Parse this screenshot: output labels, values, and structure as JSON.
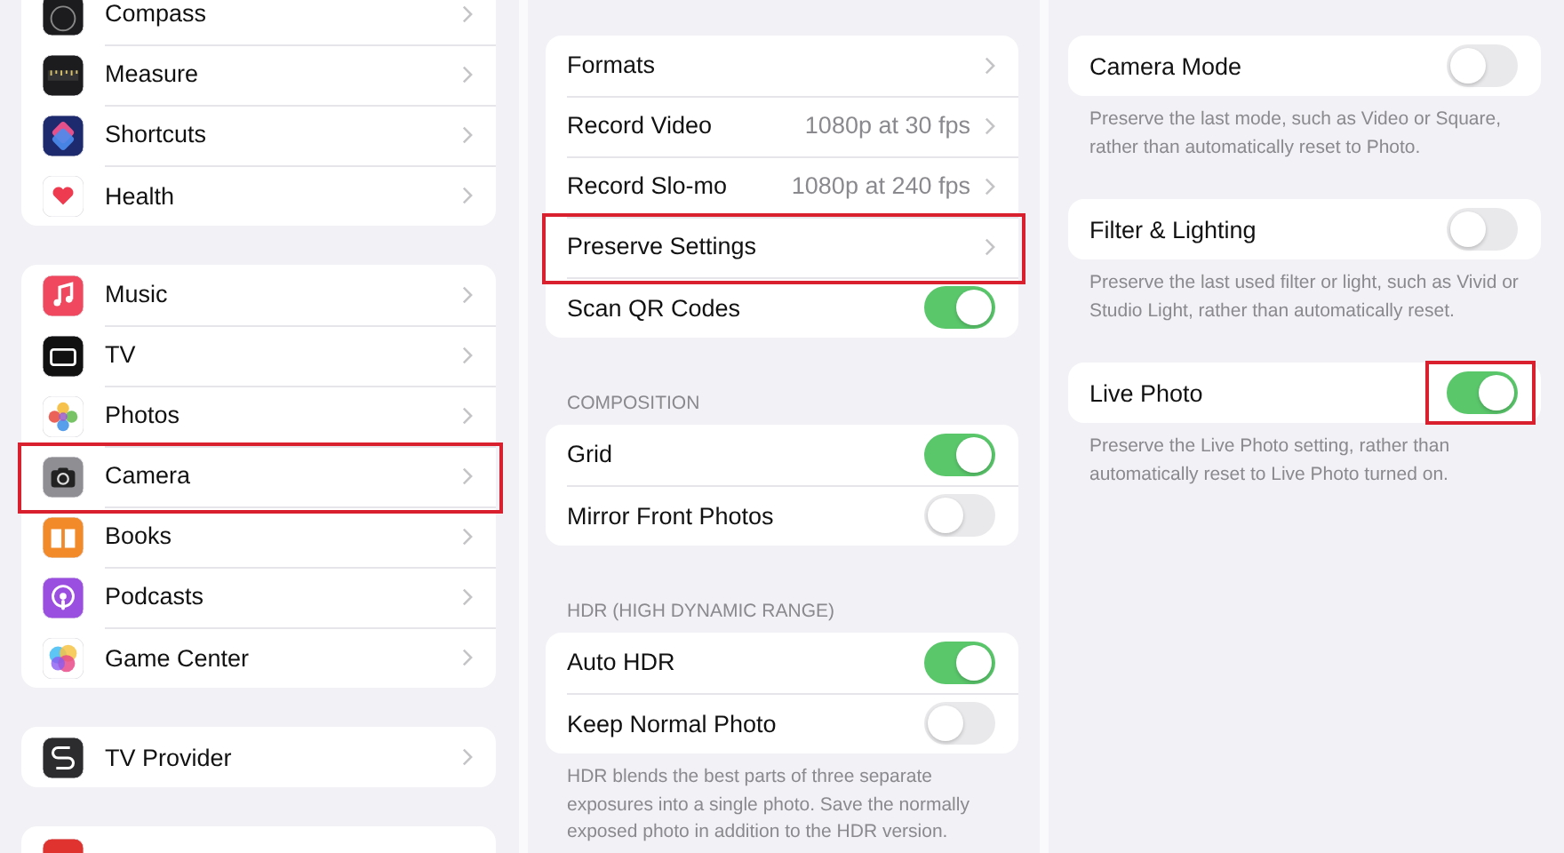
{
  "panels": [
    {
      "groups": [
        {
          "rows": [
            {
              "kind": "link",
              "label": "Compass",
              "highlighted": false
            },
            {
              "kind": "link",
              "label": "Measure",
              "highlighted": false
            },
            {
              "kind": "link",
              "label": "Shortcuts",
              "highlighted": false
            },
            {
              "kind": "link",
              "label": "Health",
              "highlighted": false
            }
          ]
        },
        {
          "rows": [
            {
              "kind": "link",
              "label": "Music",
              "highlighted": false
            },
            {
              "kind": "link",
              "label": "TV",
              "highlighted": false
            },
            {
              "kind": "link",
              "label": "Photos",
              "highlighted": false
            },
            {
              "kind": "link",
              "label": "Camera",
              "highlighted": true
            },
            {
              "kind": "link",
              "label": "Books",
              "highlighted": false
            },
            {
              "kind": "link",
              "label": "Podcasts",
              "highlighted": false
            },
            {
              "kind": "link",
              "label": "Game Center",
              "highlighted": false
            }
          ]
        },
        {
          "rows": [
            {
              "kind": "link",
              "label": "TV Provider",
              "highlighted": false
            }
          ]
        },
        {
          "rows": [
            {
              "kind": "cut"
            }
          ]
        }
      ]
    },
    {
      "groups": [
        {
          "rows": [
            {
              "kind": "link",
              "label": "Formats",
              "highlighted": false
            },
            {
              "kind": "value",
              "label": "Record Video",
              "value": "1080p at 30 fps",
              "highlighted": false
            },
            {
              "kind": "value",
              "label": "Record Slo-mo",
              "value": "1080p at 240 fps",
              "highlighted": false
            },
            {
              "kind": "link",
              "label": "Preserve Settings",
              "highlighted": true
            },
            {
              "kind": "toggle",
              "label": "Scan QR Codes",
              "on": true,
              "highlighted": false
            }
          ]
        },
        {
          "header": "COMPOSITION",
          "rows": [
            {
              "kind": "toggle",
              "label": "Grid",
              "on": true,
              "highlighted": false
            },
            {
              "kind": "toggle",
              "label": "Mirror Front Photos",
              "on": false,
              "highlighted": false
            }
          ]
        },
        {
          "header": "HDR (HIGH DYNAMIC RANGE)",
          "rows": [
            {
              "kind": "toggle",
              "label": "Auto HDR",
              "on": true,
              "highlighted": false
            },
            {
              "kind": "toggle",
              "label": "Keep Normal Photo",
              "on": false,
              "highlighted": false
            }
          ],
          "footer": "HDR blends the best parts of three separate exposures into a single photo. Save the normally exposed photo in addition to the HDR version."
        }
      ]
    },
    {
      "groups": [
        {
          "rows": [
            {
              "kind": "toggle",
              "label": "Camera Mode",
              "on": false,
              "highlighted": false
            }
          ],
          "footer": "Preserve the last mode, such as Video or Square, rather than automatically reset to Photo."
        },
        {
          "rows": [
            {
              "kind": "toggle",
              "label": "Filter & Lighting",
              "on": false,
              "highlighted": false
            }
          ],
          "footer": "Preserve the last used filter or light, such as Vivid or Studio Light, rather than automatically reset."
        },
        {
          "rows": [
            {
              "kind": "toggle",
              "label": "Live Photo",
              "on": true,
              "highlighted": true
            }
          ],
          "footer": "Preserve the Live Photo setting, rather than automatically reset to Live Photo turned on."
        }
      ]
    }
  ]
}
